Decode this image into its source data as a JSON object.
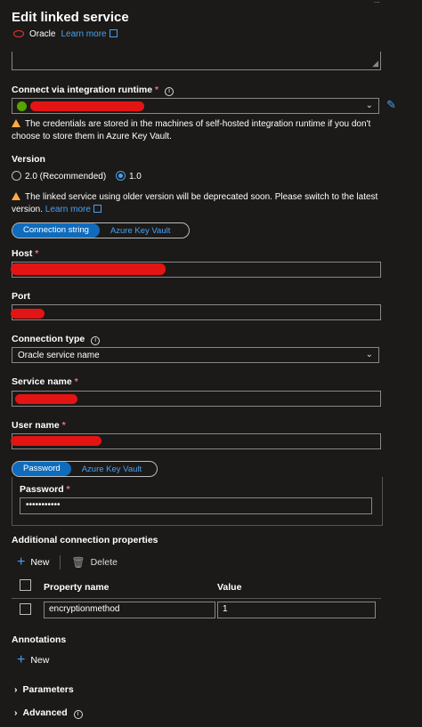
{
  "header": {
    "title": "Edit linked service",
    "service_type": "Oracle",
    "learn_more": "Learn more",
    "corner_text": "..."
  },
  "runtime": {
    "label": "Connect via integration runtime",
    "required": "*",
    "info": "i",
    "warning": "The credentials are stored in the machines of self-hosted integration runtime if you don't choose to store them in Azure Key Vault."
  },
  "version": {
    "label": "Version",
    "options": [
      "2.0 (Recommended)",
      "1.0"
    ],
    "selected": "1.0",
    "warning": "The linked service using older version will be deprecated soon. Please switch to the latest version.",
    "learn_more": "Learn more"
  },
  "auth_toggle": {
    "active": "Connection string",
    "inactive": "Azure Key Vault"
  },
  "host": {
    "label": "Host",
    "required": "*"
  },
  "port": {
    "label": "Port"
  },
  "connection_type": {
    "label": "Connection type",
    "info": "i",
    "value": "Oracle service name"
  },
  "service_name": {
    "label": "Service name",
    "required": "*"
  },
  "user_name": {
    "label": "User name",
    "required": "*"
  },
  "password_toggle": {
    "active": "Password",
    "inactive": "Azure Key Vault"
  },
  "password": {
    "label": "Password",
    "required": "*",
    "value": "•••••••••••"
  },
  "additional": {
    "label": "Additional connection properties",
    "new": "New",
    "delete": "Delete",
    "columns": [
      "Property name",
      "Value"
    ],
    "rows": [
      {
        "name": "encryptionmethod",
        "value": "1"
      }
    ]
  },
  "annotations": {
    "label": "Annotations",
    "new": "New"
  },
  "parameters": {
    "label": "Parameters"
  },
  "advanced": {
    "label": "Advanced",
    "info": "i"
  },
  "colors": {
    "background": "#1b1a19",
    "accent": "#0f6cbd",
    "link": "#4aa0f0",
    "warning": "#ffaa44",
    "required": "#f1707b"
  }
}
